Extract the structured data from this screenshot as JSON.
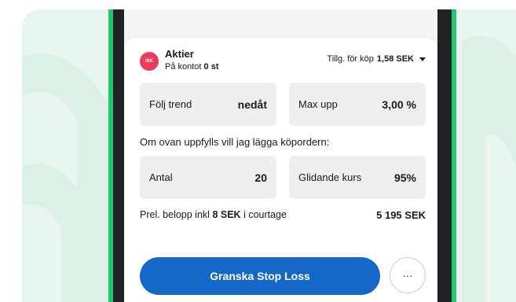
{
  "account": {
    "badge": "ISK",
    "name": "Aktier",
    "balance_prefix": "På kontot",
    "balance_value": "0 st",
    "available_prefix": "Tillg. för köp",
    "available_value": "1,58 SEK"
  },
  "fields": {
    "follow_trend": {
      "label": "Följ trend",
      "value": "nedåt"
    },
    "max_up": {
      "label": "Max upp",
      "value": "3,00 %"
    },
    "quantity": {
      "label": "Antal",
      "value": "20"
    },
    "slippage": {
      "label": "Glidande kurs",
      "value": "95%"
    }
  },
  "condition_text": "Om ovan uppfylls vill jag lägga köpordern:",
  "summary": {
    "prefix": "Prel. belopp inkl",
    "fee": "8 SEK",
    "suffix": "i courtage",
    "total": "5 195 SEK"
  },
  "actions": {
    "review_label": "Granska Stop Loss",
    "more_label": "···"
  },
  "colors": {
    "accent": "#1668c8",
    "badge": "#ee3a5d",
    "phone_edge": "#27c46f",
    "background": "#e8f6ef"
  }
}
